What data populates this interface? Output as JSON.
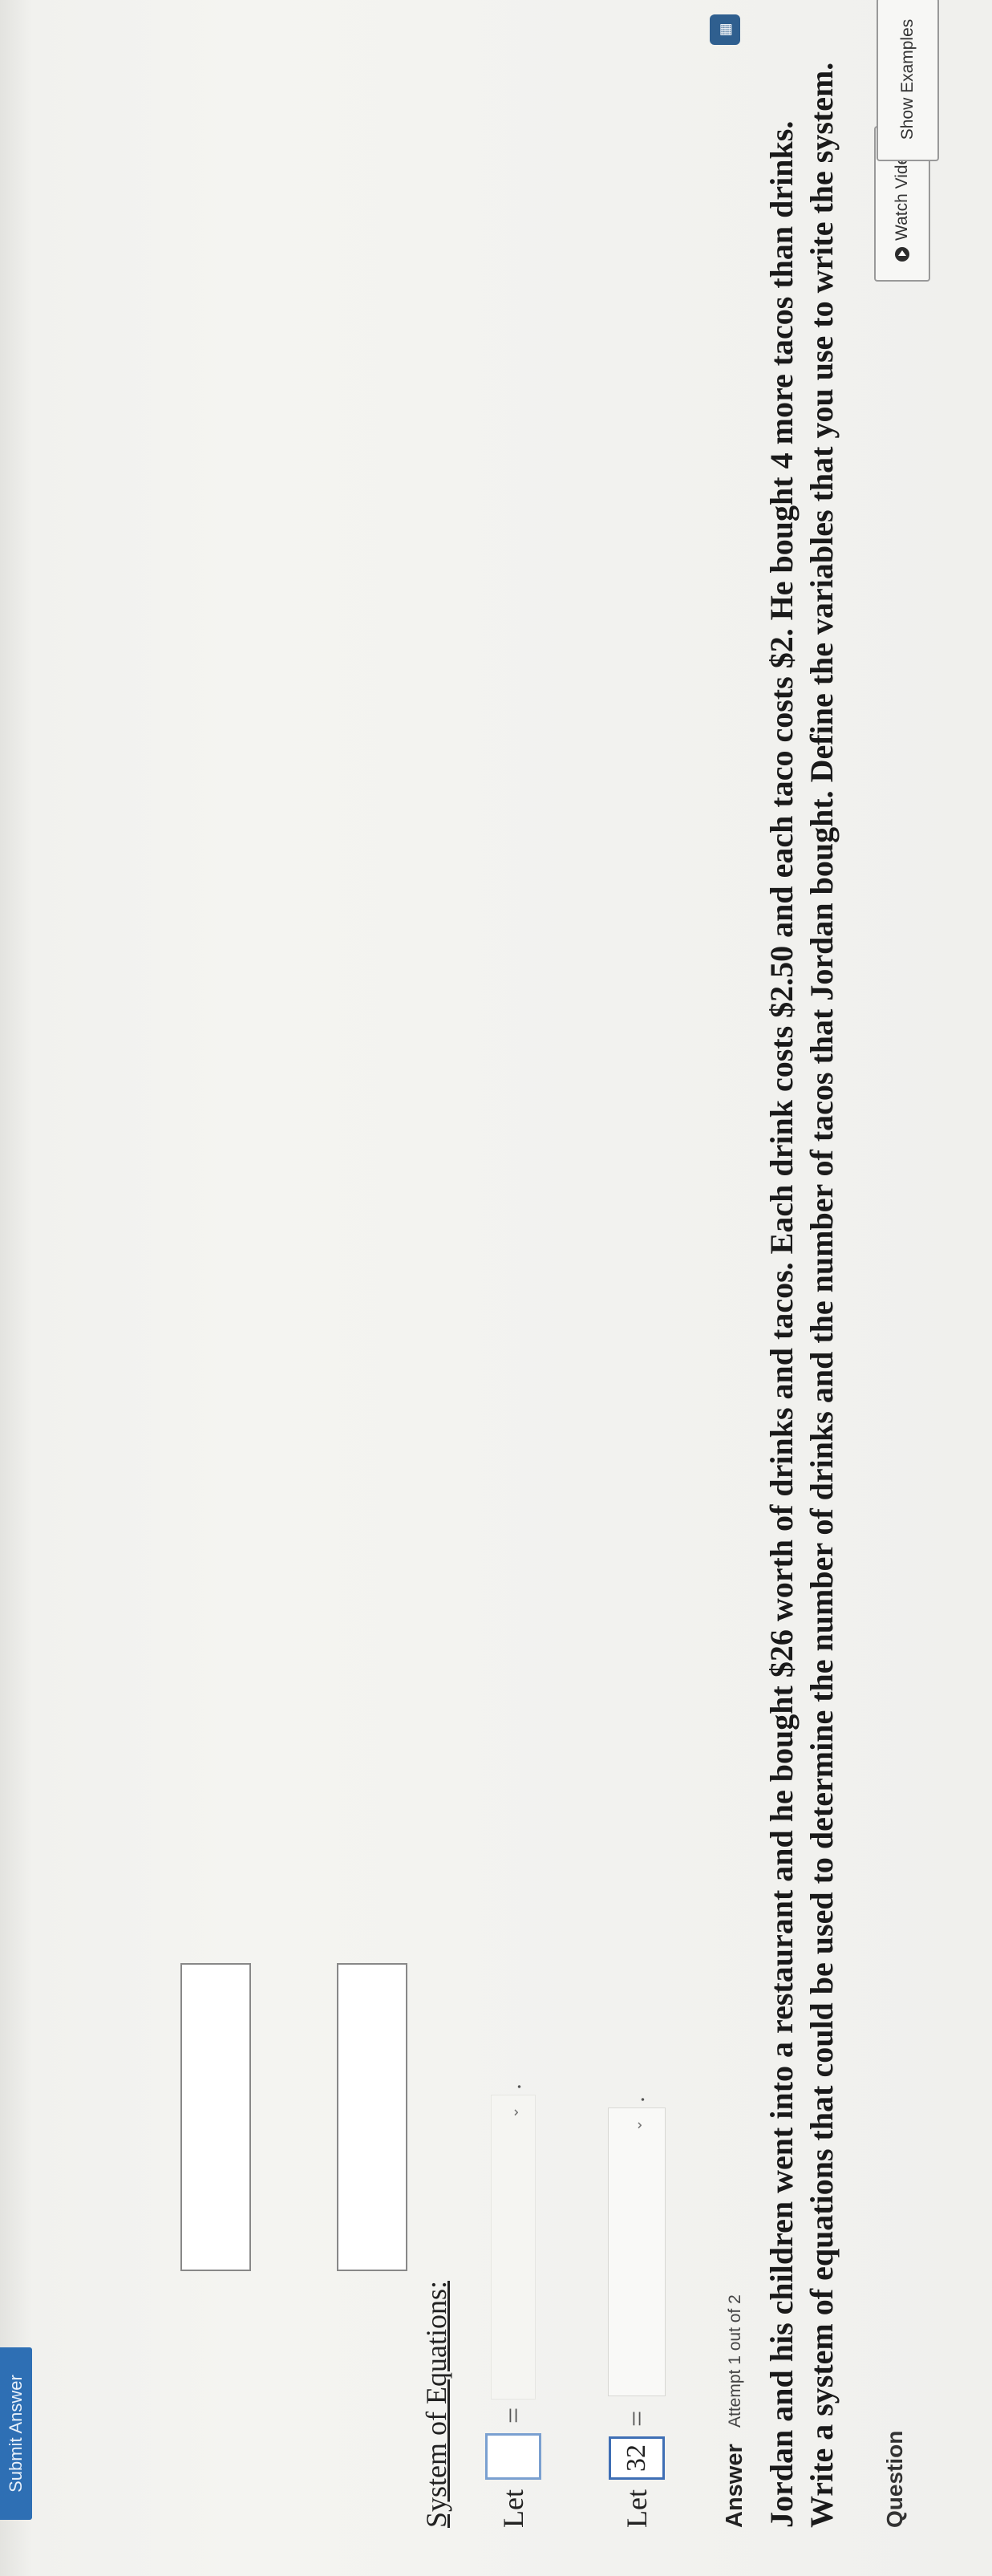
{
  "question": {
    "label": "Question",
    "text": "Jordan and his children went into a restaurant and he bought $26 worth of drinks and tacos. Each drink costs $2.50 and each taco costs $2. He bought 4 more tacos than drinks. Write a system of equations that could be used to determine the number of drinks and the number of tacos that Jordan bought. Define the variables that you use to write the system."
  },
  "buttons": {
    "watch_video": "Watch Video",
    "show_examples": "Show Examples",
    "submit": "Submit Answer"
  },
  "answer": {
    "label": "Answer",
    "attempt": "Attempt 1 out of 2"
  },
  "variables": [
    {
      "let_label": "Let",
      "value": "32",
      "equals": "=",
      "select_value": "",
      "period": "."
    },
    {
      "let_label": "Let",
      "value": "",
      "equals": "=",
      "select_value": "",
      "period": "."
    }
  ],
  "system": {
    "title": "System of Equations:",
    "equation1": "",
    "equation2": ""
  },
  "icons": {
    "play": "play-circle-icon",
    "calculator": "calculator-icon",
    "chevron": "chevron-down-icon"
  },
  "colors": {
    "accent": "#2e6fb4",
    "input_focus_border": "#3f6fb5"
  }
}
